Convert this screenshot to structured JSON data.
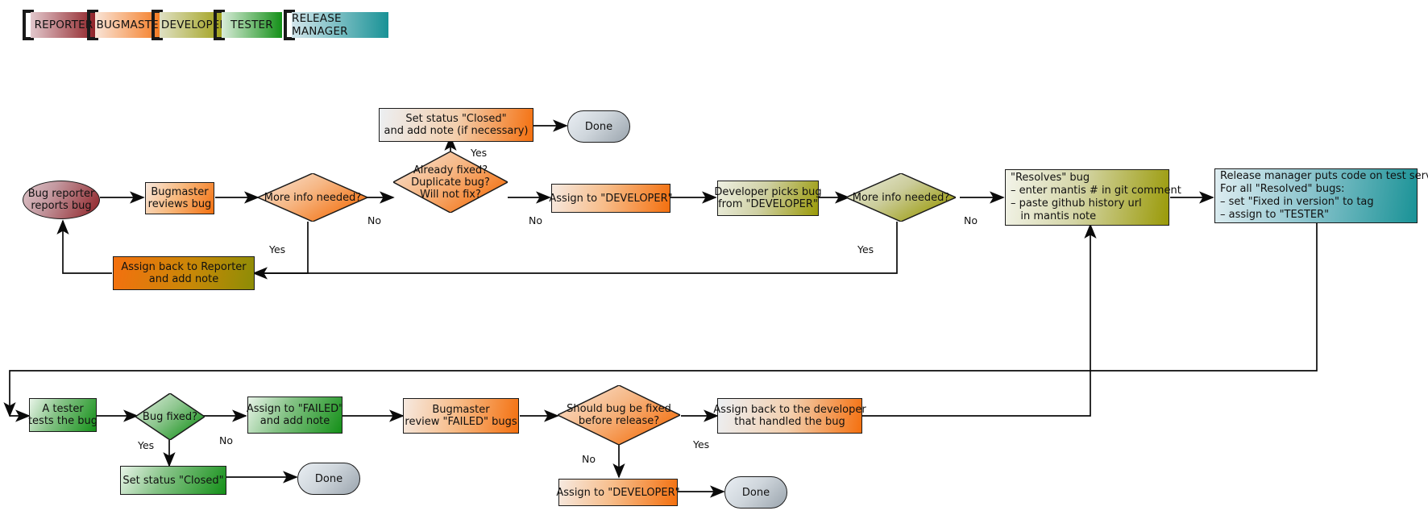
{
  "legend": {
    "items": [
      {
        "label": "REPORTER",
        "color_from": "#e2c7cc",
        "color_to": "#8e1f24"
      },
      {
        "label": "BUGMASTER",
        "color_from": "#f9e4d7",
        "color_to": "#f4700f"
      },
      {
        "label": "DEVELOPER",
        "color_from": "#dfe0c3",
        "color_to": "#9a9a08"
      },
      {
        "label": "TESTER",
        "color_from": "#d9ecd9",
        "color_to": "#149018"
      },
      {
        "label": "RELEASE MANAGER",
        "color_from": "#d4e6ec",
        "color_to": "#199296"
      }
    ]
  },
  "nodes": {
    "bug_reporter_reports_bug": "Bug reporter\nreports bug",
    "bugmaster_reviews_bug": "Bugmaster\nreviews bug",
    "more_info_needed_1": "More info needed?",
    "already_fixed": "Already fixed?\nDuplicate bug?\nWill not fix?",
    "set_status_closed_note": "Set status \"Closed\"\nand add note (if necessary)",
    "done_1": "Done",
    "assign_to_developer_1": "Assign to \"DEVELOPER\"",
    "developer_picks_bug": "Developer picks bug\nfrom \"DEVELOPER\"",
    "more_info_needed_2": "More info needed?",
    "resolves_bug": "\"Resolves\" bug\n– enter mantis # in git comment\n– paste github history url\n   in mantis note",
    "release_manager": "Release manager puts code on test server\nFor all \"Resolved\" bugs:\n– set \"Fixed in version\" to tag\n– assign to \"TESTER\"",
    "assign_back_to_reporter": "Assign back to Reporter\nand add note",
    "a_tester_tests_the_bug": "A tester\ntests the bug",
    "bug_fixed": "Bug fixed?",
    "assign_to_failed": "Assign to \"FAILED\"\nand add note",
    "bugmaster_review_failed": "Bugmaster\nreview \"FAILED\" bugs",
    "should_bug_be_fixed": "Should bug be fixed\nbefore release?",
    "assign_back_to_developer": "Assign back to the developer\nthat handled the bug",
    "set_status_closed": "Set status \"Closed\"",
    "done_2": "Done",
    "assign_to_developer_2": "Assign to \"DEVELOPER\"",
    "done_3": "Done"
  },
  "edge_labels": {
    "yes_already_fixed": "Yes",
    "no_more_info_1": "No",
    "yes_more_info_1": "Yes",
    "no_already_fixed": "No",
    "yes_more_info_2": "Yes",
    "no_more_info_2": "No",
    "yes_bug_fixed": "Yes",
    "no_bug_fixed": "No",
    "no_should_fix": "No",
    "yes_should_fix": "Yes"
  },
  "colors": {
    "reporter_from": "#e2c7cc",
    "reporter_to": "#8e1f24",
    "bugmaster_from": "#f7e7dc",
    "bugmaster_to": "#f4700f",
    "developer_from": "#dfe0c3",
    "developer_to": "#9a9a08",
    "tester_from": "#dff0df",
    "tester_to": "#149018",
    "release_from": "#d4e6ec",
    "release_to": "#199296",
    "terminal_from": "#e9eef3",
    "terminal_to": "#9aa4ad",
    "reporter_to_developer_from": "#f4700f",
    "reporter_to_developer_to": "#8d8d06",
    "stroke": "#1b1b1b"
  }
}
